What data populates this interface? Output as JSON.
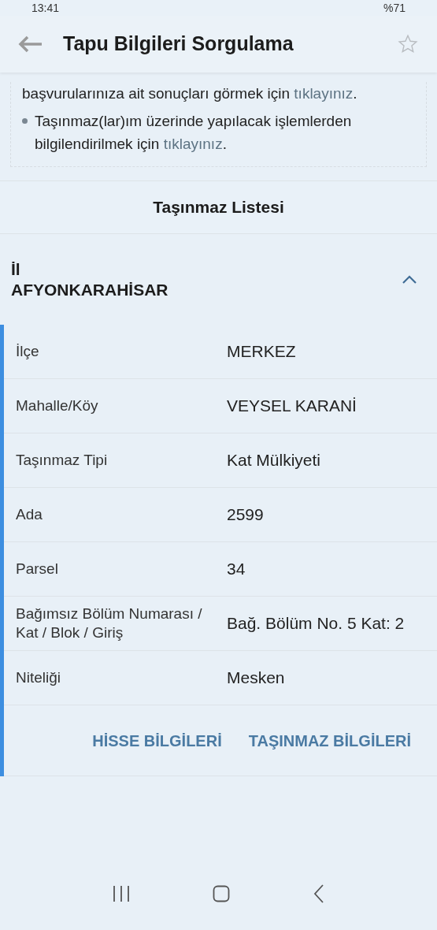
{
  "status_bar": {
    "time": "13:41",
    "battery": "%71"
  },
  "app_bar": {
    "title": "Tapu Bilgileri Sorgulama",
    "favorite": false
  },
  "info": [
    {
      "text": "başvurularınıza ait sonuçları görmek için ",
      "link": "tıklayınız",
      "after": ".",
      "bullet": false
    },
    {
      "text": "Taşınmaz(lar)ım üzerinde yapılacak işlemlerden bilgilendirilmek için ",
      "link": "tıklayınız",
      "after": ".",
      "bullet": true
    }
  ],
  "list_title": "Taşınmaz Listesi",
  "property": {
    "label": "İl",
    "value": "AFYONKARAHİSAR",
    "expanded": true,
    "rows": [
      {
        "label": "İlçe",
        "value": "MERKEZ"
      },
      {
        "label": "Mahalle/Köy",
        "value": "VEYSEL KARANİ"
      },
      {
        "label": "Taşınmaz Tipi",
        "value": "Kat Mülkiyeti"
      },
      {
        "label": "Ada",
        "value": "2599"
      },
      {
        "label": "Parsel",
        "value": "34"
      },
      {
        "label": "Bağımsız Bölüm Numarası / Kat / Blok / Giriş",
        "value": "Bağ. Bölüm No. 5 Kat: 2"
      },
      {
        "label": "Niteliği",
        "value": "Mesken"
      }
    ],
    "actions": [
      "HİSSE BİLGİLERİ",
      "TAŞINMAZ BİLGİLERİ"
    ]
  }
}
